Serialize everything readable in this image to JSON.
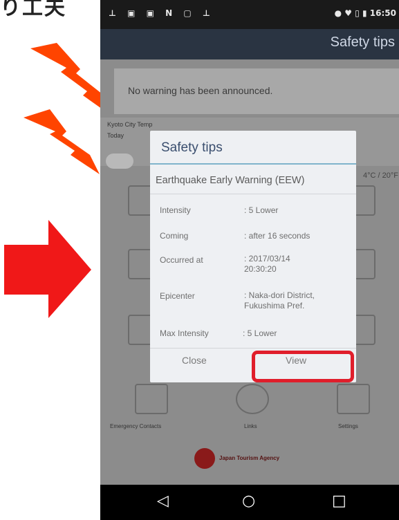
{
  "banner": {
    "text": "り工夫"
  },
  "status_bar": {
    "left_icons": "⊥ ▣ ▣ N ▢ ⊥",
    "right_icons": "● ♥ ▯ ▮",
    "time": "16:50"
  },
  "app_bar": {
    "title": "Safety tips"
  },
  "warning_card": {
    "message": "No warning has been announced."
  },
  "weather": {
    "location_label": "Kyoto City Temp",
    "sub_label": "Today",
    "temperature": "4°C / 20°F"
  },
  "dialog": {
    "title": "Safety tips",
    "subtitle": "Earthquake Early Warning (EEW)",
    "rows": [
      {
        "label": "Intensity",
        "value": ": 5 Lower"
      },
      {
        "label": "Coming",
        "value": ": after 16 seconds"
      },
      {
        "label": "Occurred at",
        "value": ": 2017/03/14 20:30:20"
      },
      {
        "label": "Epicenter",
        "value": ": Naka-dori District, Fukushima Pref."
      },
      {
        "label": "Max Intensity",
        "value": ": 5 Lower"
      }
    ],
    "close_label": "Close",
    "view_label": "View"
  },
  "menu": {
    "items": [
      "Emergency Contacts",
      "Links",
      "Settings"
    ]
  },
  "footer": {
    "logo_text": "Japan Tourism Agency"
  },
  "nav": {
    "back": "◁",
    "home": "○",
    "recents": "□"
  },
  "colors": {
    "highlight": "#e01e2b",
    "annotation": "#ff4400",
    "arrow": "#f01818"
  }
}
